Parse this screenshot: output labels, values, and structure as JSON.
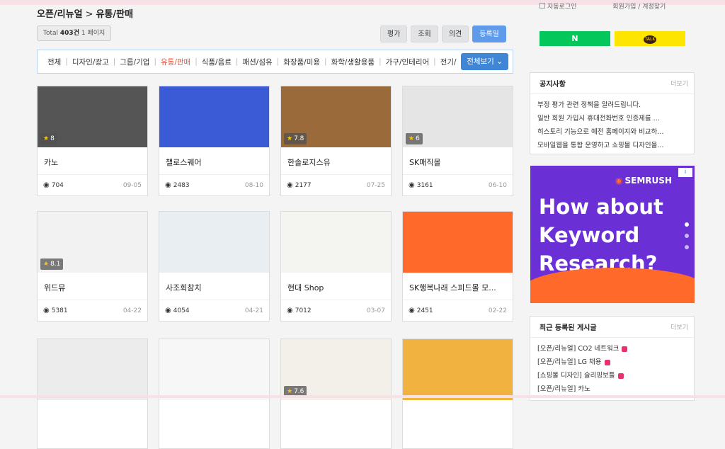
{
  "breadcrumb": {
    "parent": "오픈/리뉴얼",
    "separator": ">",
    "current": "유통/판매"
  },
  "total": {
    "label": "Total",
    "count": "403건",
    "pages": "1 페이지"
  },
  "sort_buttons": [
    "평가",
    "조회",
    "의견",
    "등록일"
  ],
  "categories": [
    "전체",
    "디자인/광고",
    "그룹/기업",
    "유통/판매",
    "식품/음료",
    "패션/섬유",
    "화장품/미용",
    "화학/생활용품",
    "가구/인테리어",
    "전기/"
  ],
  "all_view_label": "전체보기",
  "cards": [
    {
      "title": "카노",
      "rating": "8",
      "views": "704",
      "date": "09-05",
      "theme": "#555"
    },
    {
      "title": "챌로스퀘어",
      "rating": "",
      "views": "2483",
      "date": "08-10",
      "theme": "#3b5bd6"
    },
    {
      "title": "한솔로지스유",
      "rating": "7.8",
      "views": "2177",
      "date": "07-25",
      "theme": "#9a6a3a"
    },
    {
      "title": "SK매직몰",
      "rating": "6",
      "views": "3161",
      "date": "06-10",
      "theme": "#e5e5e5"
    },
    {
      "title": "위드뮤",
      "rating": "8.1",
      "views": "5381",
      "date": "04-22",
      "theme": "#f2f2f2"
    },
    {
      "title": "사조회참치",
      "rating": "",
      "views": "4054",
      "date": "04-21",
      "theme": "#e9eef3"
    },
    {
      "title": "현대 Shop",
      "rating": "",
      "views": "7012",
      "date": "03-07",
      "theme": "#f4f4f0"
    },
    {
      "title": "SK행복나래 스피드몰 모...",
      "rating": "",
      "views": "2451",
      "date": "02-22",
      "theme": "#ff6a2b"
    },
    {
      "title": "",
      "rating": "",
      "views": "",
      "date": "",
      "theme": "#ececec"
    },
    {
      "title": "",
      "rating": "",
      "views": "",
      "date": "",
      "theme": "#f7f7f7"
    },
    {
      "title": "",
      "rating": "7.6",
      "views": "",
      "date": "",
      "theme": "#f3efe9"
    },
    {
      "title": "",
      "rating": "",
      "views": "",
      "date": "",
      "theme": "#f2b240"
    }
  ],
  "login": {
    "auto_login": "자동로그인",
    "join": "회원가입",
    "find": "계정찾기"
  },
  "social": {
    "naver": "N",
    "kakao": "TALK"
  },
  "notice": {
    "title": "공지사항",
    "more": "더보기",
    "items": [
      "부정 평가 관련 정책을 알려드립니다.",
      "일반 회원 가입시 휴대전화번호 인증제를 ...",
      "히스토리 기능으로 예전 홈페이지와 비교하...",
      "모바일웹을 통합 운영하고 쇼핑몰 디자인을..."
    ]
  },
  "ad": {
    "brand": "SEMRUSH",
    "headline": "How about Keyword Research?",
    "info": "i"
  },
  "recent": {
    "title": "최근 등록된 게시글",
    "more": "더보기",
    "items": [
      "[오픈/리뉴얼] CO2 네트워크",
      "[오픈/리뉴얼] LG 채용",
      "[쇼핑몰 디자인] 슬리핑보틀",
      "[오픈/리뉴얼] 카노"
    ]
  }
}
